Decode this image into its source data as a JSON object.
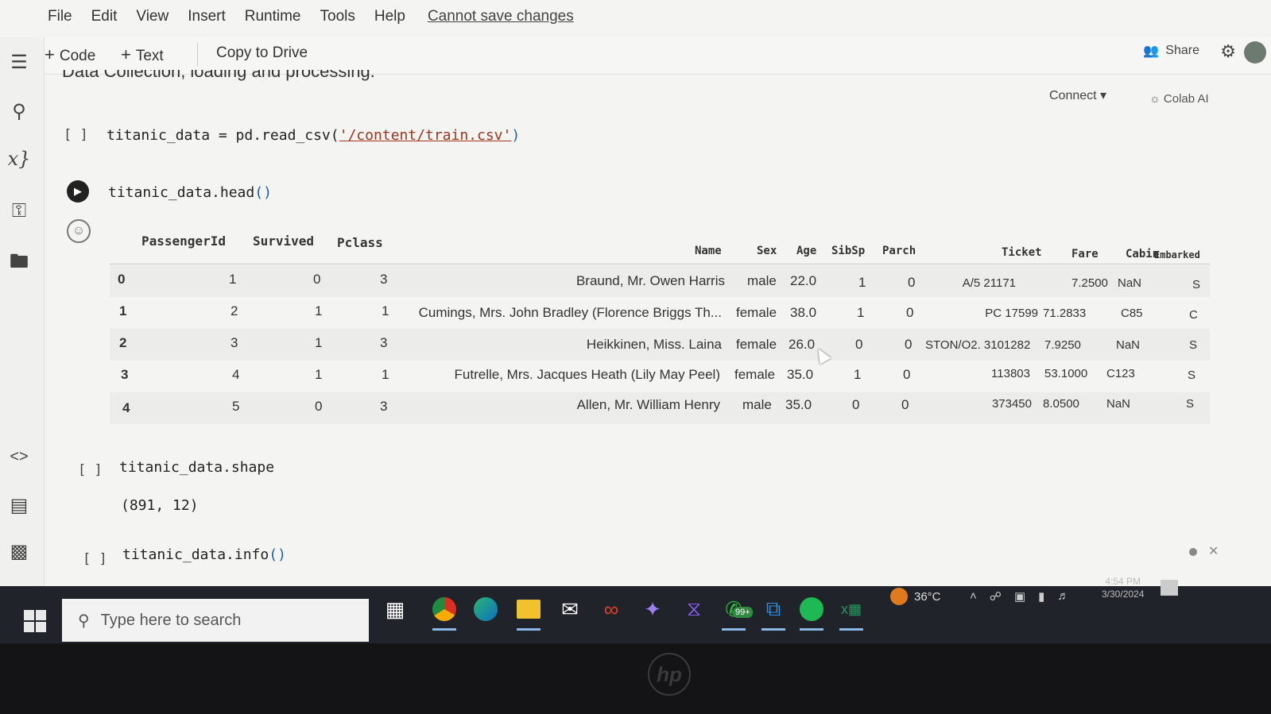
{
  "menu": {
    "items": [
      "File",
      "Edit",
      "View",
      "Insert",
      "Runtime",
      "Tools",
      "Help"
    ],
    "unsaved_notice": "Cannot save changes"
  },
  "toolbar": {
    "code_label": "Code",
    "text_label": "Text",
    "copy_label": "Copy to Drive",
    "share_label": "Share",
    "connect_label": "Connect",
    "colab_ai_label": "Colab AI"
  },
  "section": {
    "title": "Data Collection, loading and processing."
  },
  "cells": {
    "read_csv": {
      "bracket": "[ ]",
      "code_prefix": "titanic_data = pd.read_csv(",
      "code_string": "'/content/train.csv'",
      "code_suffix": ")"
    },
    "head": {
      "code": "titanic_data.head",
      "parens": "()"
    },
    "shape": {
      "bracket": "[ ]",
      "code": "titanic_data.shape",
      "output": "(891, 12)"
    },
    "info": {
      "bracket": "[ ]",
      "code": "titanic_data.info",
      "parens": "()"
    }
  },
  "dataframe": {
    "columns": [
      "PassengerId",
      "Survived",
      "Pclass",
      "Name",
      "Sex",
      "Age",
      "SibSp",
      "Parch",
      "Ticket",
      "Fare",
      "Cabin",
      "Embarked"
    ],
    "rows": [
      {
        "index": "0",
        "PassengerId": "1",
        "Survived": "0",
        "Pclass": "3",
        "Name": "Braund, Mr. Owen Harris",
        "Sex": "male",
        "Age": "22.0",
        "SibSp": "1",
        "Parch": "0",
        "Ticket": "A/5 21171",
        "Fare": "7.2500",
        "Cabin": "NaN",
        "Embarked": "S"
      },
      {
        "index": "1",
        "PassengerId": "2",
        "Survived": "1",
        "Pclass": "1",
        "Name": "Cumings, Mrs. John Bradley (Florence Briggs Th...",
        "Sex": "female",
        "Age": "38.0",
        "SibSp": "1",
        "Parch": "0",
        "Ticket": "PC 17599",
        "Fare": "71.2833",
        "Cabin": "C85",
        "Embarked": "C"
      },
      {
        "index": "2",
        "PassengerId": "3",
        "Survived": "1",
        "Pclass": "3",
        "Name": "Heikkinen, Miss. Laina",
        "Sex": "female",
        "Age": "26.0",
        "SibSp": "0",
        "Parch": "0",
        "Ticket": "STON/O2. 3101282",
        "Fare": "7.9250",
        "Cabin": "NaN",
        "Embarked": "S"
      },
      {
        "index": "3",
        "PassengerId": "4",
        "Survived": "1",
        "Pclass": "1",
        "Name": "Futrelle, Mrs. Jacques Heath (Lily May Peel)",
        "Sex": "female",
        "Age": "35.0",
        "SibSp": "1",
        "Parch": "0",
        "Ticket": "113803",
        "Fare": "53.1000",
        "Cabin": "C123",
        "Embarked": "S"
      },
      {
        "index": "4",
        "PassengerId": "5",
        "Survived": "0",
        "Pclass": "3",
        "Name": "Allen, Mr. William Henry",
        "Sex": "male",
        "Age": "35.0",
        "SibSp": "0",
        "Parch": "0",
        "Ticket": "373450",
        "Fare": "8.0500",
        "Cabin": "NaN",
        "Embarked": "S"
      }
    ]
  },
  "taskbar": {
    "search_placeholder": "Type here to search",
    "whatsapp_badge": "99+",
    "temperature": "36°C",
    "time": "4:54 PM",
    "date": "3/30/2024"
  },
  "icons": [
    "menu-icon",
    "search-icon",
    "variables-icon",
    "key-icon",
    "folder-icon",
    "code-snippets-icon",
    "command-palette-icon",
    "terminal-icon",
    "share-icon",
    "gear-icon",
    "play-icon",
    "windows-icon",
    "chrome-icon",
    "edge-icon",
    "file-explorer-icon",
    "mail-icon",
    "infinity-icon",
    "copilot-icon",
    "vs-icon",
    "whatsapp-icon",
    "vscode-icon",
    "spotify-icon",
    "excel-icon"
  ]
}
